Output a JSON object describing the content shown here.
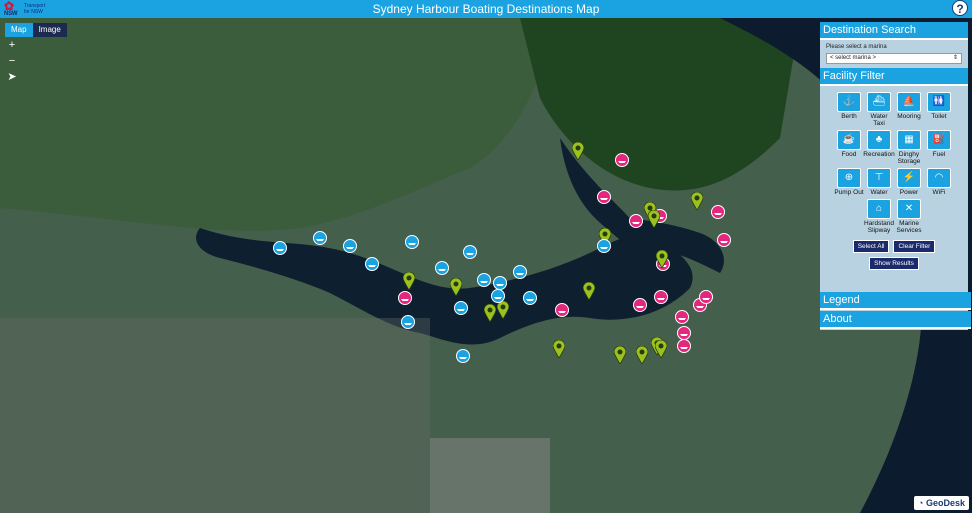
{
  "app": {
    "title": "Sydney Harbour Boating Destinations Map",
    "logo_mark": "NSW",
    "logo_text_line1": "Transport",
    "logo_text_line2": "for NSW",
    "help_label": "?"
  },
  "map_controls": {
    "tabs": [
      {
        "label": "Map",
        "active": true
      },
      {
        "label": "Image",
        "active": false
      }
    ],
    "zoom_in": "+",
    "zoom_out": "−",
    "locate": "➤"
  },
  "panel": {
    "search": {
      "header": "Destination Search",
      "prompt": "Please select a marina",
      "selected": "< select marina >"
    },
    "filter": {
      "header": "Facility Filter",
      "facilities": [
        {
          "label": "Berth",
          "icon": "berth-icon",
          "glyph": "⚓"
        },
        {
          "label": "Water Taxi",
          "icon": "water-taxi-icon",
          "glyph": "⛴"
        },
        {
          "label": "Mooring",
          "icon": "mooring-icon",
          "glyph": "⛵"
        },
        {
          "label": "Toilet",
          "icon": "toilet-icon",
          "glyph": "🚻"
        },
        {
          "label": "Food",
          "icon": "food-icon",
          "glyph": "☕"
        },
        {
          "label": "Recreation",
          "icon": "recreation-icon",
          "glyph": "♣"
        },
        {
          "label": "Dinghy Storage",
          "icon": "dinghy-storage-icon",
          "glyph": "▦"
        },
        {
          "label": "Fuel",
          "icon": "fuel-icon",
          "glyph": "⛽"
        },
        {
          "label": "Pump Out",
          "icon": "pump-out-icon",
          "glyph": "⊕"
        },
        {
          "label": "Water",
          "icon": "water-tap-icon",
          "glyph": "⊤"
        },
        {
          "label": "Power",
          "icon": "power-icon",
          "glyph": "⚡"
        },
        {
          "label": "WiFi",
          "icon": "wifi-icon",
          "glyph": "◠"
        },
        {
          "label": "Hardstand Slipway",
          "icon": "hardstand-slipway-icon",
          "glyph": "⌂"
        },
        {
          "label": "Marine Services",
          "icon": "marine-services-icon",
          "glyph": "✕"
        }
      ],
      "select_all": "Select All",
      "clear_filter": "Clear Filter",
      "show_results": "Show Results"
    },
    "legend": "Legend",
    "about": "About"
  },
  "attribution": "GeoDesk",
  "colors": {
    "accent": "#1aa3e0",
    "marker_pink": "#e5267e",
    "marker_green": "#9ac21f",
    "marker_blue": "#1aa3e0",
    "button_navy": "#1b2a6b"
  }
}
